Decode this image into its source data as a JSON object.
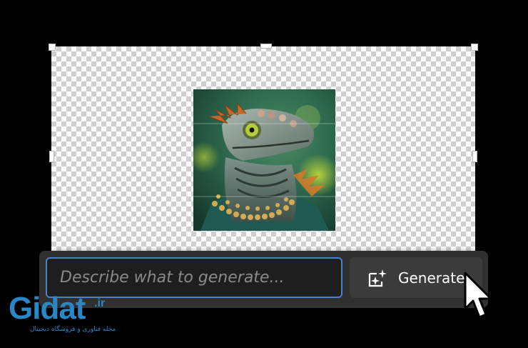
{
  "taskbar": {
    "prompt_placeholder": "Describe what to generate...",
    "generate_label": "Generate",
    "generate_icon": "generative-fill-icon"
  },
  "watermark": {
    "logo_text": "Gidat",
    "tld": ".ir",
    "tagline": "مجله فناوری و فروشگاه دیجیتال"
  },
  "colors": {
    "background": "#000000",
    "taskbar": "#303030",
    "input_border": "#4a82c7",
    "brand": "#2b86c5"
  }
}
